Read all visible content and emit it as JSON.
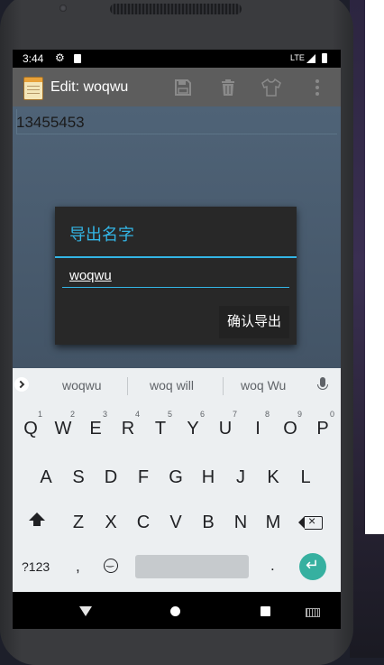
{
  "status_bar": {
    "time": "3:44",
    "network": "LTE"
  },
  "app_bar": {
    "title": "Edit: woqwu",
    "actions": [
      "save-icon",
      "delete-icon",
      "shirt-icon",
      "overflow-icon"
    ]
  },
  "editor": {
    "text": "13455453"
  },
  "dialog": {
    "title": "导出名字",
    "input_value": "woqwu",
    "confirm_label": "确认导出",
    "accent_color": "#33b5e5"
  },
  "keyboard": {
    "suggestions": [
      "woqwu",
      "woq will",
      "woq Wu"
    ],
    "row1": [
      "Q",
      "W",
      "E",
      "R",
      "T",
      "Y",
      "U",
      "I",
      "O",
      "P"
    ],
    "row1_hints": [
      "1",
      "2",
      "3",
      "4",
      "5",
      "6",
      "7",
      "8",
      "9",
      "0"
    ],
    "row2": [
      "A",
      "S",
      "D",
      "F",
      "G",
      "H",
      "J",
      "K",
      "L"
    ],
    "row3": [
      "Z",
      "X",
      "C",
      "V",
      "B",
      "N",
      "M"
    ],
    "symbols_label": "?123",
    "comma": ",",
    "period": ".",
    "enter_color": "#36b0a0"
  }
}
